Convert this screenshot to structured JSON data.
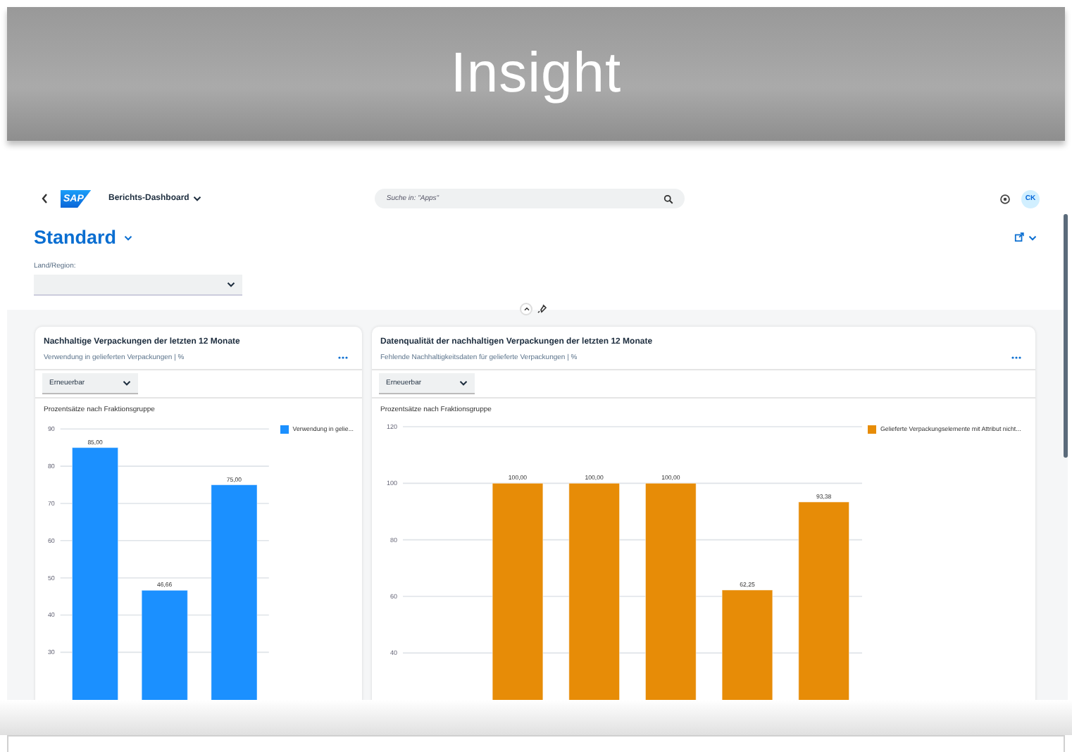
{
  "banner": {
    "title": "Insight"
  },
  "shell": {
    "logo": "SAP",
    "app_title": "Berichts-Dashboard",
    "search": {
      "placeholder": "Suche in: \"Apps\""
    },
    "avatar": "CK"
  },
  "page": {
    "variant": "Standard",
    "filters": [
      {
        "label": "Land/Region:"
      }
    ]
  },
  "cards": [
    {
      "title": "Nachhaltige Verpackungen der letzten 12 Monate",
      "subtitle": "Verwendung in gelieferten Verpackungen | %",
      "dropdown": "Erneuerbar",
      "chart_data": {
        "type": "bar",
        "title": "Prozentsätze nach Fraktionsgruppe",
        "ylim": [
          0,
          90
        ],
        "yticks": [
          30,
          40,
          50,
          60,
          70,
          80,
          90
        ],
        "grid": true,
        "value_labels": [
          "85,00",
          "46,66",
          "75,00"
        ],
        "series": [
          {
            "name": "Verwendung in gelie...",
            "color": "#1b90ff",
            "values": [
              85,
              46.66,
              75
            ]
          }
        ]
      }
    },
    {
      "title": "Datenqualität der nachhaltigen Verpackungen der letzten 12 Monate",
      "subtitle": "Fehlende Nachhaltigkeitsdaten für gelieferte Verpackungen | %",
      "dropdown": "Erneuerbar",
      "chart_data": {
        "type": "bar",
        "title": "Prozentsätze nach Fraktionsgruppe",
        "ylim": [
          0,
          120
        ],
        "yticks": [
          40,
          60,
          80,
          100,
          120
        ],
        "grid": true,
        "value_labels": [
          null,
          "100,00",
          "100,00",
          "100,00",
          "62,25",
          "93,38"
        ],
        "series": [
          {
            "name": "Gelieferte Verpackungselemente mit Attribut nicht...",
            "color": "#e78c07",
            "values": [
              null,
              100,
              100,
              100,
              62.25,
              93.38
            ]
          }
        ]
      }
    }
  ]
}
